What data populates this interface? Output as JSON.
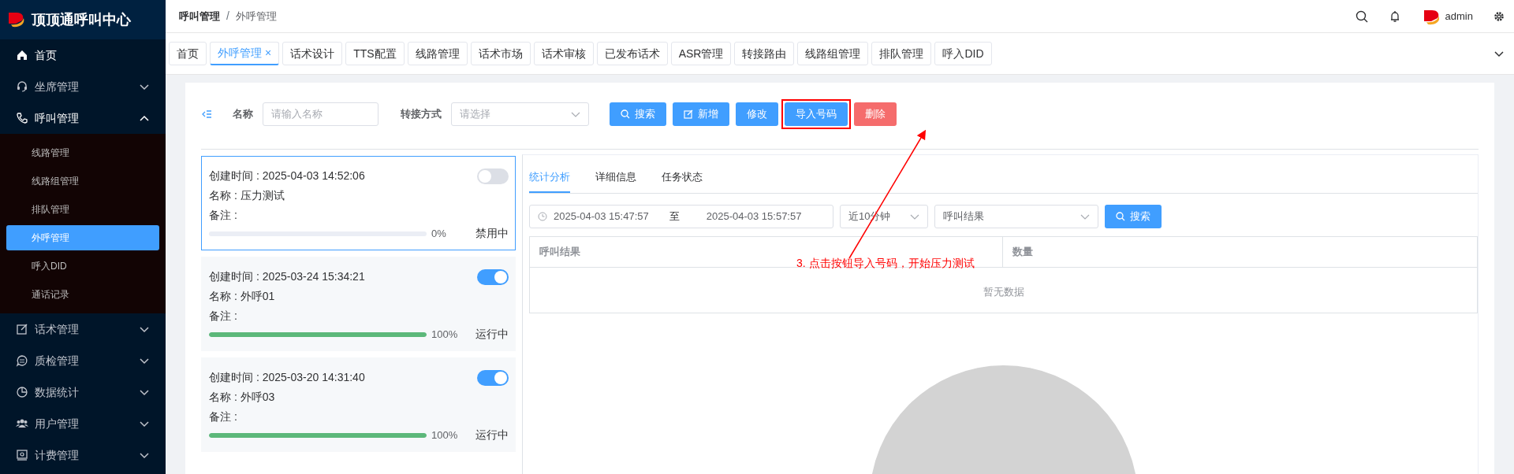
{
  "app": {
    "title": "顶顶通呼叫中心"
  },
  "sidebar": {
    "items": [
      {
        "label": "首页",
        "kind": "link"
      },
      {
        "label": "坐席管理",
        "kind": "group",
        "expanded": false
      },
      {
        "label": "呼叫管理",
        "kind": "group",
        "expanded": true,
        "children": [
          {
            "label": "线路管理",
            "selected": false
          },
          {
            "label": "线路组管理",
            "selected": false
          },
          {
            "label": "排队管理",
            "selected": false
          },
          {
            "label": "外呼管理",
            "selected": true
          },
          {
            "label": "呼入DID",
            "selected": false
          },
          {
            "label": "通话记录",
            "selected": false
          }
        ]
      },
      {
        "label": "话术管理",
        "kind": "group",
        "expanded": false
      },
      {
        "label": "质检管理",
        "kind": "group",
        "expanded": false
      },
      {
        "label": "数据统计",
        "kind": "group",
        "expanded": false
      },
      {
        "label": "用户管理",
        "kind": "group",
        "expanded": false
      },
      {
        "label": "计费管理",
        "kind": "group",
        "expanded": false
      }
    ]
  },
  "header": {
    "breadcrumb": [
      "呼叫管理",
      "外呼管理"
    ],
    "separator": "/",
    "user": "admin"
  },
  "tabs": [
    {
      "label": "首页",
      "selected": false
    },
    {
      "label": "外呼管理",
      "selected": true,
      "close": "×"
    },
    {
      "label": "话术设计",
      "selected": false
    },
    {
      "label": "TTS配置",
      "selected": false
    },
    {
      "label": "线路管理",
      "selected": false
    },
    {
      "label": "话术市场",
      "selected": false
    },
    {
      "label": "话术审核",
      "selected": false
    },
    {
      "label": "已发布话术",
      "selected": false
    },
    {
      "label": "ASR管理",
      "selected": false
    },
    {
      "label": "转接路由",
      "selected": false
    },
    {
      "label": "线路组管理",
      "selected": false
    },
    {
      "label": "排队管理",
      "selected": false
    },
    {
      "label": "呼入DID",
      "selected": false
    }
  ],
  "filters": [
    {
      "label": "名称",
      "placeholder": "请输入名称",
      "kind": "input"
    },
    {
      "label": "转接方式",
      "placeholder": "请选择",
      "kind": "select"
    }
  ],
  "buttons": [
    {
      "label": "搜索",
      "kind": "search",
      "annotated": false
    },
    {
      "label": "新增",
      "kind": "add",
      "annotated": false
    },
    {
      "label": "修改",
      "kind": "primary",
      "annotated": false
    },
    {
      "label": "导入号码",
      "kind": "primary",
      "annotated": true
    },
    {
      "label": "删除",
      "kind": "danger",
      "annotated": false
    }
  ],
  "tasks": [
    {
      "created": "创建时间 : 2025-04-03 14:52:06",
      "name": "名称 : 压力测试",
      "note": "备注 :",
      "on": false,
      "level": 0,
      "percent": "0%",
      "status": "禁用中",
      "selected": true
    },
    {
      "created": "创建时间 : 2025-03-24 15:34:21",
      "name": "名称 : 外呼01",
      "note": "备注 :",
      "on": true,
      "level": 1,
      "percent": "100%",
      "status": "运行中",
      "selected": false
    },
    {
      "created": "创建时间 : 2025-03-20 14:31:40",
      "name": "名称 : 外呼03",
      "note": "备注 :",
      "on": true,
      "level": 1,
      "percent": "100%",
      "status": "运行中",
      "selected": false
    }
  ],
  "detail": {
    "tabs": [
      {
        "label": "统计分析",
        "selected": true
      },
      {
        "label": "详细信息",
        "selected": false
      },
      {
        "label": "任务状态",
        "selected": false
      }
    ],
    "date_start": "2025-04-03 15:47:57",
    "date_sep": "至",
    "date_end": "2025-04-03 15:57:57",
    "range": "近10分钟",
    "result_select": "呼叫结果",
    "search_button": "搜索",
    "table": {
      "columns": [
        "呼叫结果",
        "数量"
      ],
      "empty_text": "暂无数据"
    }
  },
  "annotation": {
    "text": "3. 点击按钮导入号码，开始压力测试"
  }
}
